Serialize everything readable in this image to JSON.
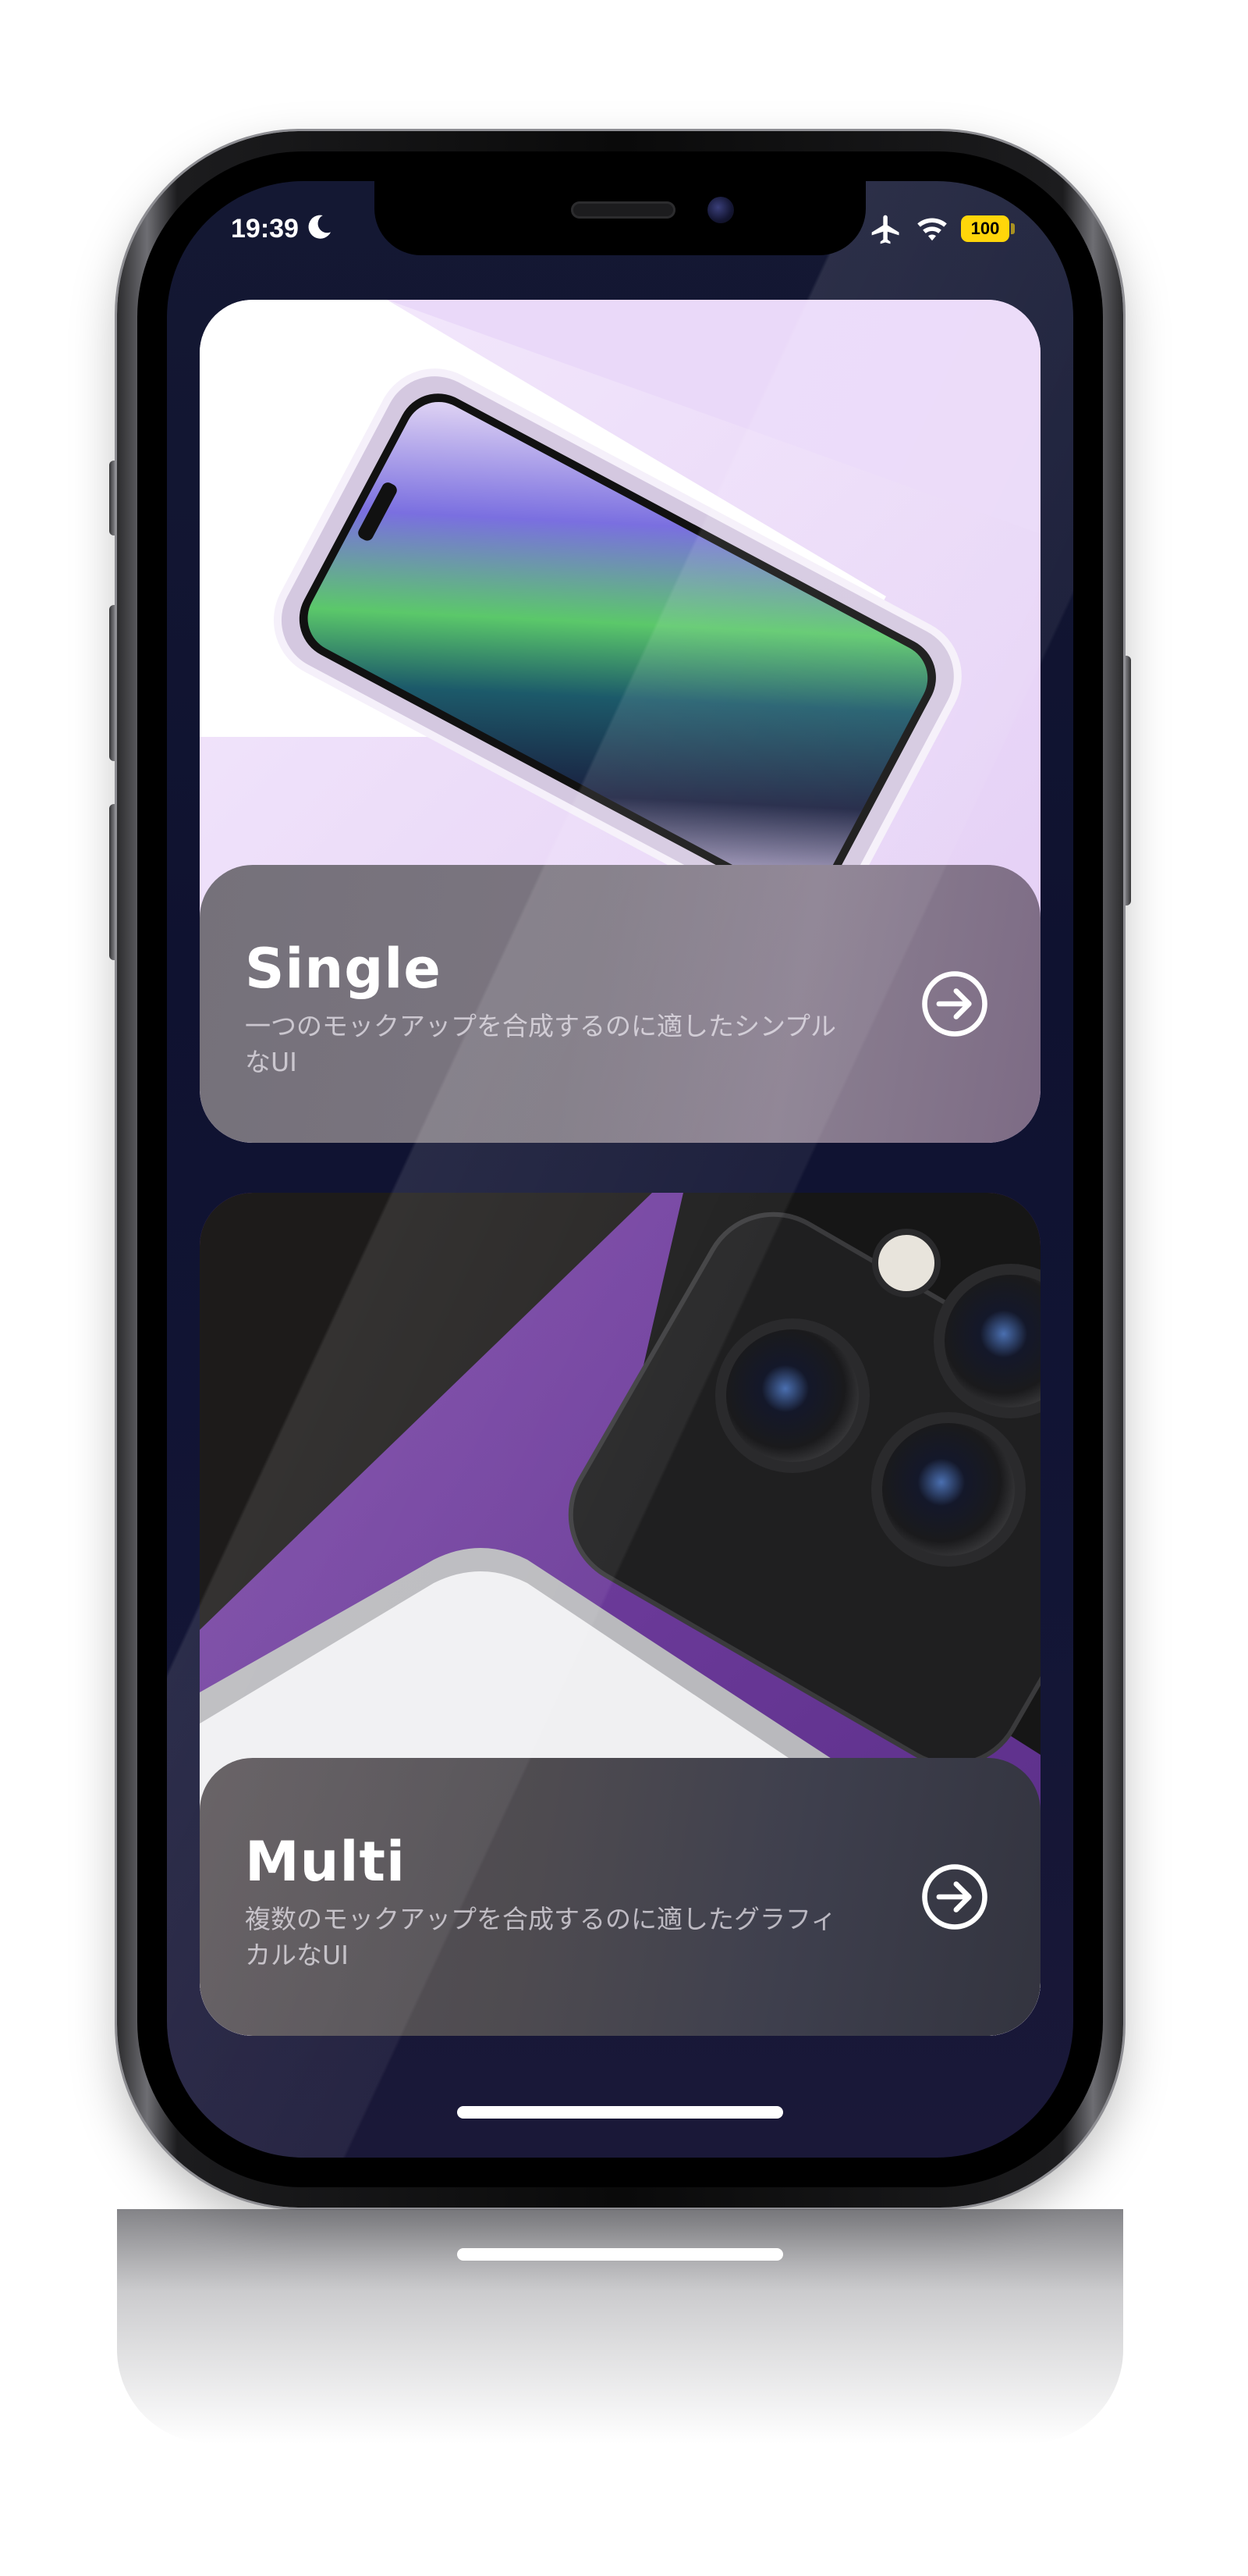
{
  "status_bar": {
    "time": "19:39",
    "battery": "100",
    "icons": [
      "moon-icon",
      "airplane-icon",
      "wifi-icon",
      "battery-icon"
    ]
  },
  "cards": [
    {
      "title": "Single",
      "description": "一つのモックアップを合成するのに適したシンプルなUI",
      "action_icon": "arrow-right-circle-icon"
    },
    {
      "title": "Multi",
      "description": "複数のモックアップを合成するのに適したグラフィカルなUI",
      "action_icon": "arrow-right-circle-icon"
    }
  ],
  "colors": {
    "screen_background": "#121535",
    "battery": "#ffd60a",
    "single_card_bg": "#ecdcf8",
    "multi_accent": "#6a3aa0"
  }
}
